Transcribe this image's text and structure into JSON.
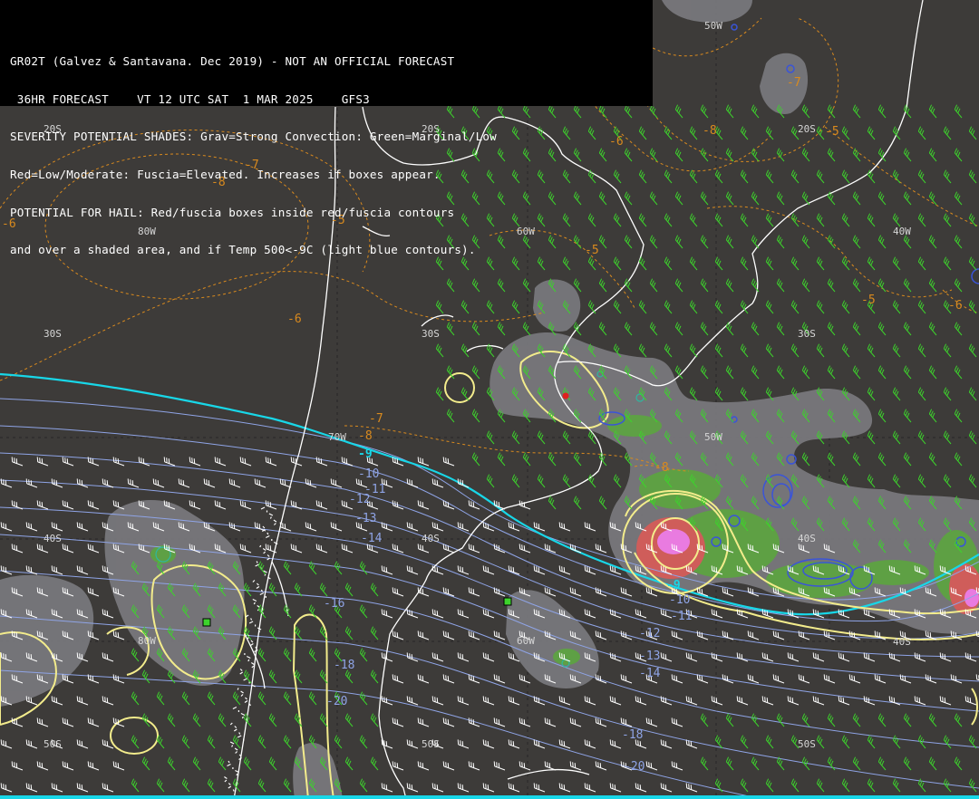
{
  "header": {
    "lines": [
      "GR02T (Galvez & Santavana. Dec 2019) - NOT AN OFFICIAL FORECAST",
      " 36HR FORECAST    VT 12 UTC SAT  1 MAR 2025    GFS3",
      "SEVERITY POTENTIAL SHADES: Grav=Strong Convection: Green=Marginal/Low",
      "Red=Low/Moderate: Fuscia=Elevated. Increases if boxes appear.",
      "POTENTIAL FOR HAIL: Red/fuscia boxes inside red/fuscia contours",
      "and over a shaded area, and if Temp 500<-9C (light blue contours)."
    ]
  },
  "grid_labels": [
    {
      "id": "lat-20s-a",
      "text": "20S"
    },
    {
      "id": "lat-20s-b",
      "text": "20S"
    },
    {
      "id": "lat-20s-c",
      "text": "20S"
    },
    {
      "id": "lat-30s-a",
      "text": "30S"
    },
    {
      "id": "lat-30s-b",
      "text": "30S"
    },
    {
      "id": "lat-30s-c",
      "text": "30S"
    },
    {
      "id": "lat-40s-a",
      "text": "40S"
    },
    {
      "id": "lat-40s-b",
      "text": "40S"
    },
    {
      "id": "lat-40s-c",
      "text": "40S"
    },
    {
      "id": "lat-40s-d",
      "text": "40S"
    },
    {
      "id": "lat-50s-a",
      "text": "50S"
    },
    {
      "id": "lat-50s-b",
      "text": "50S"
    },
    {
      "id": "lat-50s-c",
      "text": "50S"
    },
    {
      "id": "lon-80w-a",
      "text": "80W"
    },
    {
      "id": "lon-80w-b",
      "text": "80W"
    },
    {
      "id": "lon-70w",
      "text": "70W"
    },
    {
      "id": "lon-60w-a",
      "text": "60W"
    },
    {
      "id": "lon-60w-b",
      "text": "60W"
    },
    {
      "id": "lon-50w-a",
      "text": "50W"
    },
    {
      "id": "lon-50w-b",
      "text": "50W"
    },
    {
      "id": "lon-40w",
      "text": "40W"
    }
  ],
  "temp_labels": [
    {
      "id": "t-6-a",
      "text": "-6",
      "kind": "orange"
    },
    {
      "id": "t-7-a",
      "text": "-7",
      "kind": "orange"
    },
    {
      "id": "t-8-a",
      "text": "-8",
      "kind": "orange"
    },
    {
      "id": "t-5-a",
      "text": "-5",
      "kind": "orange"
    },
    {
      "id": "t-6-b",
      "text": "-6",
      "kind": "orange"
    },
    {
      "id": "t-7-b",
      "text": "-7",
      "kind": "orange"
    },
    {
      "id": "t-8-b",
      "text": "-8",
      "kind": "orange"
    },
    {
      "id": "t-6-c",
      "text": "-6",
      "kind": "orange"
    },
    {
      "id": "t-5-b",
      "text": "-5",
      "kind": "orange"
    },
    {
      "id": "t-5-c",
      "text": "-5",
      "kind": "orange"
    },
    {
      "id": "t-5-d",
      "text": "-5",
      "kind": "orange"
    },
    {
      "id": "t-6-d",
      "text": "-6",
      "kind": "orange"
    },
    {
      "id": "t-7-c",
      "text": "-7",
      "kind": "orange"
    },
    {
      "id": "t-8-c",
      "text": "-8",
      "kind": "orange"
    },
    {
      "id": "t-8-d",
      "text": "-8",
      "kind": "orange"
    },
    {
      "id": "t-9-a",
      "text": "-9",
      "kind": "cyan"
    },
    {
      "id": "t-9-b",
      "text": "-9",
      "kind": "cyan"
    },
    {
      "id": "t-10-a",
      "text": "-10",
      "kind": "blue"
    },
    {
      "id": "t-11-a",
      "text": "-11",
      "kind": "blue"
    },
    {
      "id": "t-12-a",
      "text": "-12",
      "kind": "blue"
    },
    {
      "id": "t-13-a",
      "text": "-13",
      "kind": "blue"
    },
    {
      "id": "t-14-a",
      "text": "-14",
      "kind": "blue"
    },
    {
      "id": "t-16-a",
      "text": "-16",
      "kind": "blue"
    },
    {
      "id": "t-18-a",
      "text": "-18",
      "kind": "blue"
    },
    {
      "id": "t-20-a",
      "text": "-20",
      "kind": "blue"
    },
    {
      "id": "t-10-b",
      "text": "-10",
      "kind": "blue"
    },
    {
      "id": "t-11-b",
      "text": "-11",
      "kind": "blue"
    },
    {
      "id": "t-12-b",
      "text": "-12",
      "kind": "blue"
    },
    {
      "id": "t-13-b",
      "text": "-13",
      "kind": "blue"
    },
    {
      "id": "t-14-b",
      "text": "-14",
      "kind": "blue"
    },
    {
      "id": "t-18-b",
      "text": "-18",
      "kind": "blue"
    },
    {
      "id": "t-20-b",
      "text": "-20",
      "kind": "blue"
    }
  ],
  "colors": {
    "background": "#3d3b39",
    "coastline": "#ffffff",
    "grid": "#262626",
    "lat_lon_label": "#d6d6d6",
    "temp_orange": "#d98a1e",
    "temp_cyan": "#18d7e8",
    "temp_blue": "#8fa4e6",
    "shade_gray": "#7b7b7f",
    "shade_green": "#5aa83c",
    "shade_red": "#cf5d5a",
    "shade_fuscia": "#e97be0",
    "severity_contour": "#f3ec8c",
    "low_contour": "#3a54d8",
    "wind_green": "#3dd32c",
    "wind_white": "#ffffff"
  }
}
